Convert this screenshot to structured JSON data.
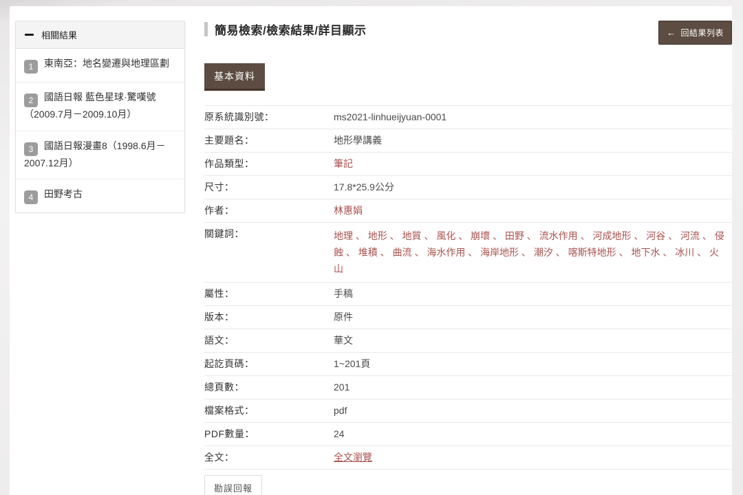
{
  "colors": {
    "accent_brown": "#5c4c41",
    "accent_brown_dark": "#46322a",
    "link_red": "#a9524e",
    "badge_gray": "#9c9c9c"
  },
  "sidebar": {
    "header": "相關結果",
    "items": [
      {
        "num": "1",
        "title": "東南亞：地名變遷與地理區劃"
      },
      {
        "num": "2",
        "title": "國語日報 藍色星球·驚嘆號（2009.7月－2009.10月）"
      },
      {
        "num": "3",
        "title": "國語日報漫畫8（1998.6月－2007.12月）"
      },
      {
        "num": "4",
        "title": "田野考古"
      }
    ]
  },
  "header": {
    "breadcrumb": "簡易檢索/檢索結果/詳目顯示",
    "back_icon": "←",
    "back_label": "回結果列表"
  },
  "tabs": {
    "basic_info": "基本資料"
  },
  "record": {
    "separator": "、",
    "rows": [
      {
        "label": "原系統識別號：",
        "value": "ms2021-linhueijyuan-0001",
        "style": "text"
      },
      {
        "label": "主要題名：",
        "value": "地形學講義",
        "style": "text"
      },
      {
        "label": "作品類型：",
        "value": "筆記",
        "style": "link"
      },
      {
        "label": "尺寸：",
        "value": "17.8*25.9公分",
        "style": "text"
      },
      {
        "label": "作者：",
        "value": "林惠娟",
        "style": "link"
      },
      {
        "label": "關鍵詞：",
        "style": "keywords",
        "keywords": [
          "地理",
          "地形",
          "地質",
          "風化",
          "崩壞",
          "田野",
          "流水作用",
          "河成地形",
          "河谷",
          "河流",
          "侵蝕",
          "堆積",
          "曲流",
          "海水作用",
          "海岸地形",
          "潮汐",
          "喀斯特地形",
          "地下水",
          "冰川",
          "火山"
        ]
      },
      {
        "label": "屬性：",
        "value": "手稿",
        "style": "text"
      },
      {
        "label": "版本：",
        "value": "原件",
        "style": "text"
      },
      {
        "label": "語文：",
        "value": "華文",
        "style": "text"
      },
      {
        "label": "起訖頁碼：",
        "value": "1~201頁",
        "style": "text"
      },
      {
        "label": "總頁數：",
        "value": "201",
        "style": "text"
      },
      {
        "label": "檔案格式：",
        "value": "pdf",
        "style": "text"
      },
      {
        "label": "PDF數量：",
        "value": "24",
        "style": "text"
      },
      {
        "label": "全文：",
        "value": "全文瀏覽",
        "style": "link-underline"
      }
    ]
  },
  "footer": {
    "report_button": "勘誤回報"
  }
}
